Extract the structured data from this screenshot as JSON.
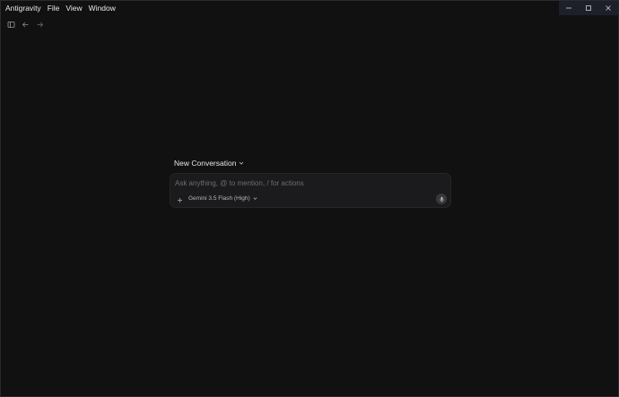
{
  "menubar": {
    "app_name": "Antigravity",
    "items": [
      "File",
      "View",
      "Window"
    ]
  },
  "window_controls": {
    "minimize_icon": "minimize-icon",
    "maximize_icon": "maximize-icon",
    "close_icon": "close-icon"
  },
  "toolbar": {
    "icons": [
      "sidebar-toggle-icon",
      "arrow-left-icon",
      "arrow-right-icon"
    ]
  },
  "conversation": {
    "title": "New Conversation"
  },
  "composer": {
    "placeholder": "Ask anything, @ to mention, / for actions",
    "model": "Gemini 3.5 Flash (High)",
    "mic_icon": "microphone-icon",
    "add_icon": "plus-icon"
  },
  "colors": {
    "background": "#111112",
    "composer_bg": "#1b1b1d",
    "titlebar_controls_bg": "#1d1f2a",
    "text_primary": "#e6e6e6",
    "text_placeholder": "#6e6e72"
  }
}
